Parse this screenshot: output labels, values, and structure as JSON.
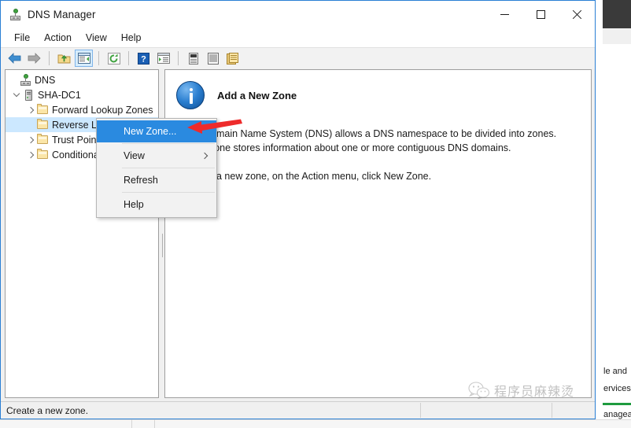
{
  "window": {
    "title": "DNS Manager",
    "icon": "dns-server-icon",
    "controls": {
      "minimize": "Minimize",
      "maximize": "Maximize",
      "close": "Close"
    }
  },
  "menubar": {
    "items": [
      {
        "label": "File"
      },
      {
        "label": "Action"
      },
      {
        "label": "View"
      },
      {
        "label": "Help"
      }
    ]
  },
  "toolbar": {
    "buttons": [
      {
        "name": "back-icon",
        "label": "Back"
      },
      {
        "name": "forward-icon",
        "label": "Forward"
      },
      {
        "name": "up-one-level-icon",
        "label": "Up One Level"
      },
      {
        "name": "show-hide-console-tree-icon",
        "label": "Show/Hide Console Tree",
        "active": true
      },
      {
        "name": "refresh-icon",
        "label": "Refresh"
      },
      {
        "name": "help-icon",
        "label": "Help"
      },
      {
        "name": "properties-icon",
        "label": "Properties"
      },
      {
        "name": "new-window-icon",
        "label": "New Window from Here"
      },
      {
        "name": "export-list-icon",
        "label": "Export List"
      },
      {
        "name": "copy-icon",
        "label": "Copy"
      }
    ]
  },
  "tree": {
    "nodes": [
      {
        "label": "DNS",
        "icon": "dns-root-icon",
        "indent": 0,
        "chevron": "none",
        "selected": false
      },
      {
        "label": "SHA-DC1",
        "icon": "server-icon",
        "indent": 1,
        "chevron": "down",
        "selected": false
      },
      {
        "label": "Forward Lookup Zones",
        "icon": "folder-icon",
        "indent": 2,
        "chevron": "right",
        "selected": false
      },
      {
        "label": "Reverse Lookup Zones",
        "icon": "folder-icon",
        "indent": 2,
        "chevron": "none",
        "selected": true
      },
      {
        "label": "Trust Points",
        "icon": "folder-icon",
        "indent": 2,
        "chevron": "right",
        "selected": false
      },
      {
        "label": "Conditional Forwarders",
        "icon": "folder-icon",
        "indent": 2,
        "chevron": "right",
        "selected": false
      }
    ]
  },
  "right_pane": {
    "icon": "info-icon",
    "title": "Add a New Zone",
    "paragraphs": [
      "The Domain Name System (DNS) allows a DNS namespace to be divided into zones. Each zone stores information about one or more contiguous DNS domains.",
      "To add a new zone, on the Action menu, click New Zone."
    ]
  },
  "context_menu": {
    "items": [
      {
        "label": "New Zone...",
        "highlighted": true,
        "submenu": false
      },
      {
        "label": "View",
        "highlighted": false,
        "submenu": true
      },
      {
        "label": "Refresh",
        "highlighted": false,
        "submenu": false
      },
      {
        "label": "Help",
        "highlighted": false,
        "submenu": false
      }
    ]
  },
  "annotation": {
    "name": "red-arrow-pointer",
    "color": "#ee2b2b",
    "points_to": "New Zone..."
  },
  "statusbar": {
    "text": "Create a new zone."
  },
  "watermark": {
    "icon": "wechat-logo",
    "text": "程序员麻辣烫"
  },
  "background": {
    "fragments": [
      {
        "text": "le and"
      },
      {
        "text": "ervices"
      },
      {
        "text": "anagea"
      }
    ],
    "accent_color": "#1f9b3f"
  },
  "colors": {
    "window_border": "#2a7fd4",
    "selection": "#cce8ff",
    "menu_highlight": "#2a8ae0",
    "toolbar_bg": "#f2f2f2",
    "annotation_red": "#ee2b2b"
  }
}
